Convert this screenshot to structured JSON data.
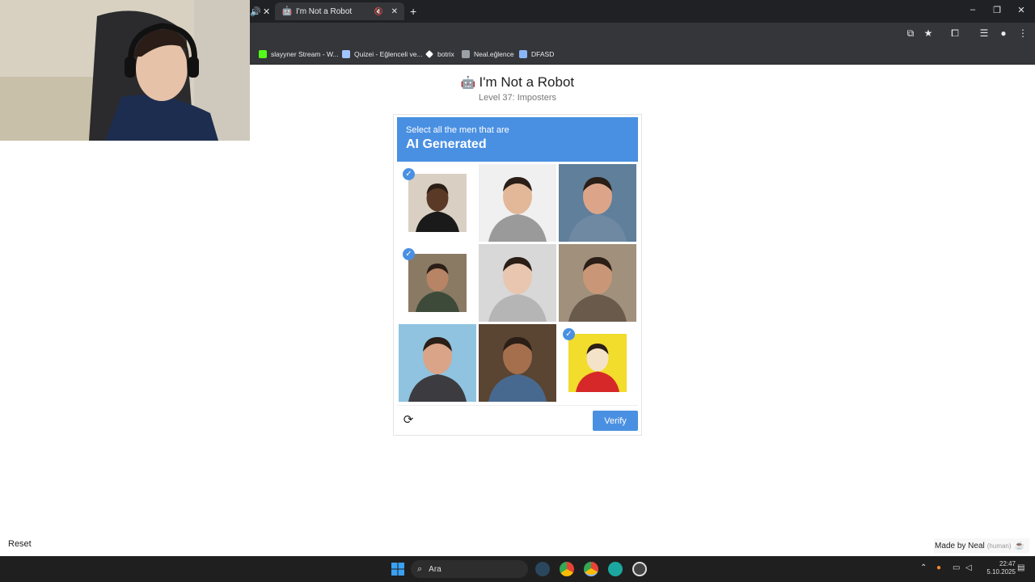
{
  "browser": {
    "active_tab_title": "I'm Not a Robot",
    "bookmarks": [
      {
        "label": "slayyner Stream - W...",
        "color": "#53fc18"
      },
      {
        "label": "Quizei - Eğlenceli ve...",
        "color": "#a0c4ff"
      },
      {
        "label": "botrix",
        "color": "#ffffff"
      },
      {
        "label": "Neal.eğlence",
        "color": "#9aa0a6"
      },
      {
        "label": "DFASD",
        "color": "#8ab4f8"
      }
    ]
  },
  "page": {
    "title": "I'm Not a Robot",
    "subtitle": "Level 37: Imposters",
    "reset_label": "Reset",
    "made_by": "Made by Neal",
    "made_by_note": "(human)"
  },
  "captcha": {
    "instruction": "Select all the men that are",
    "target": "AI Generated",
    "verify_label": "Verify",
    "tiles": [
      {
        "selected": true,
        "bg": "#d9d0c3",
        "skin": "#5a3a26",
        "shirt": "#1a1a1a"
      },
      {
        "selected": false,
        "bg": "#f0f0f0",
        "skin": "#e2b899",
        "shirt": "#9a9a9a"
      },
      {
        "selected": false,
        "bg": "#5f7f9b",
        "skin": "#dca58a",
        "shirt": "#6f89a3"
      },
      {
        "selected": true,
        "bg": "#8a7a63",
        "skin": "#b88466",
        "shirt": "#3d4a3a"
      },
      {
        "selected": false,
        "bg": "#d8d8d8",
        "skin": "#e8c6b0",
        "shirt": "#b5b5b5"
      },
      {
        "selected": false,
        "bg": "#a0907c",
        "skin": "#c99777",
        "shirt": "#6a5a4c"
      },
      {
        "selected": false,
        "bg": "#8fc3e0",
        "skin": "#d9a488",
        "shirt": "#3c3c40"
      },
      {
        "selected": false,
        "bg": "#5a4432",
        "skin": "#a56f4d",
        "shirt": "#48698f"
      },
      {
        "selected": true,
        "bg": "#f2dc2c",
        "skin": "#f4e3c8",
        "shirt": "#d62828"
      }
    ]
  },
  "taskbar": {
    "search_placeholder": "Ara",
    "time": "22:47",
    "date": "5.10.2025"
  }
}
